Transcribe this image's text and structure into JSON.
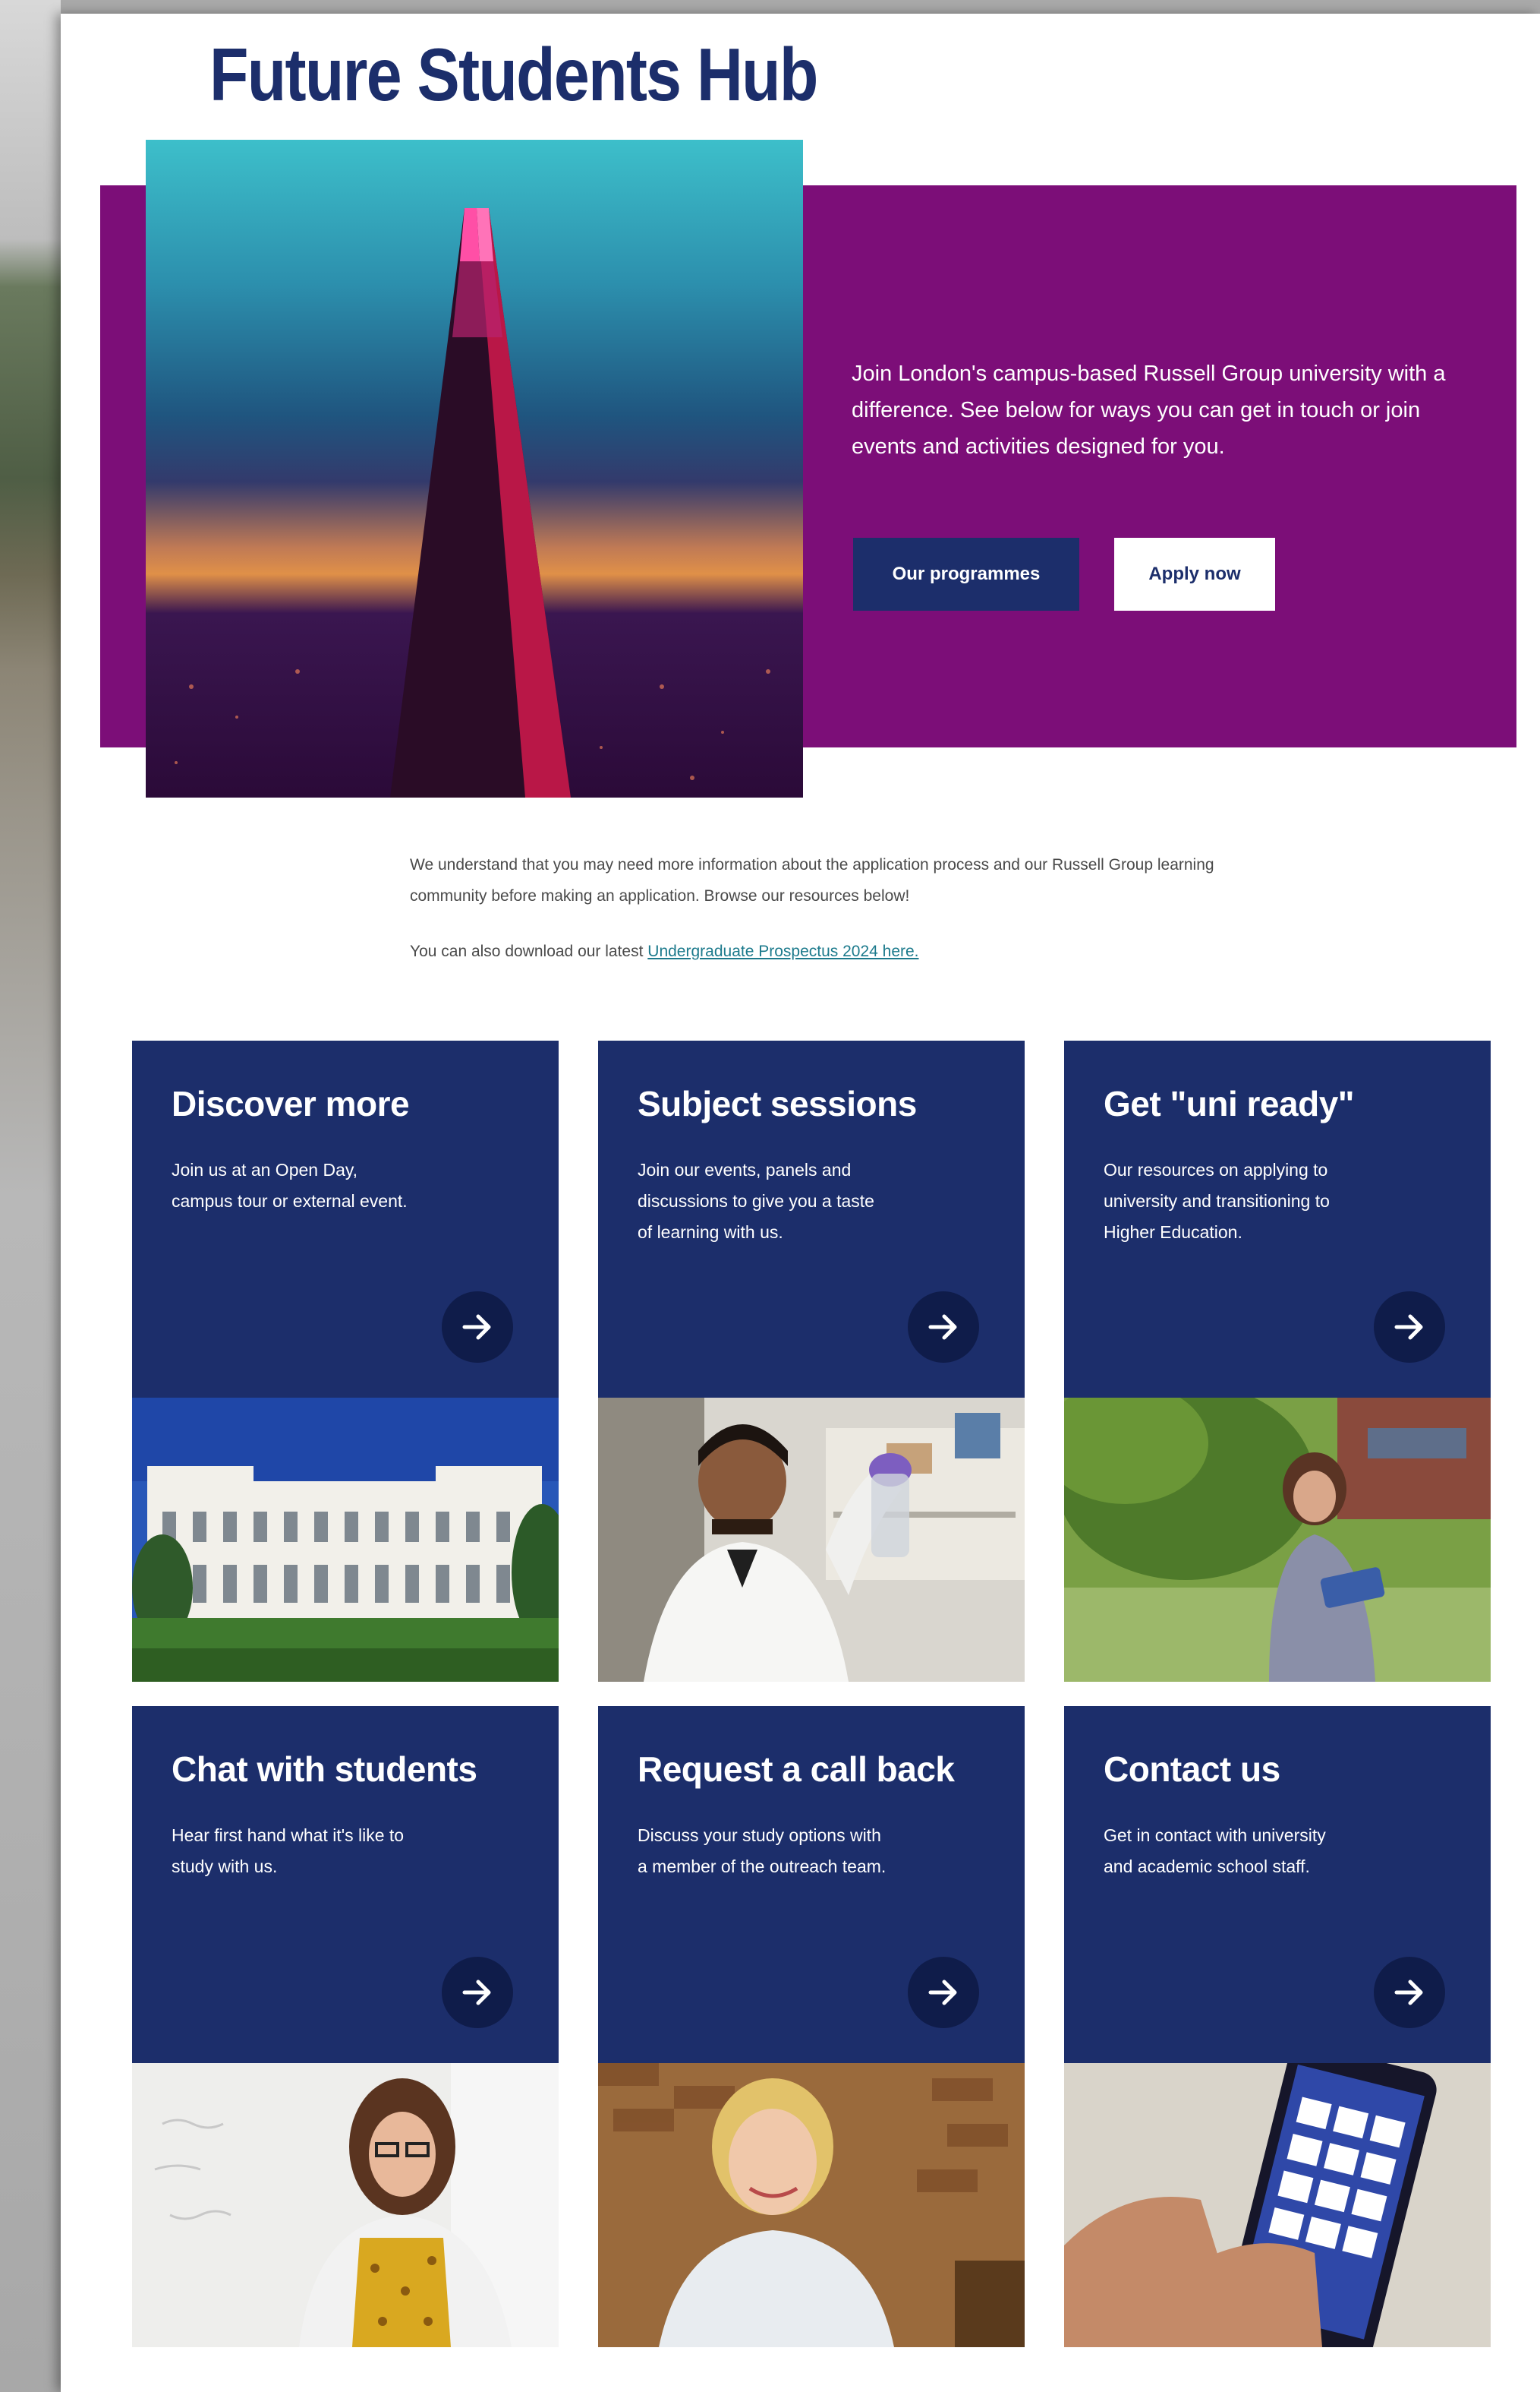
{
  "page": {
    "title": "Future Students Hub"
  },
  "hero": {
    "text": "Join London's campus-based Russell Group university with a difference. See below for ways you can get in touch or join events and activities designed for you.",
    "primary_button": "Our programmes",
    "secondary_button": "Apply now"
  },
  "intro": {
    "paragraph": "We understand that you may need more information about the application process and our Russell Group learning community before making an application. Browse our resources below!",
    "prospectus_prefix": "You can also download our latest ",
    "prospectus_link": "Undergraduate Prospectus 2024 here."
  },
  "cards": [
    {
      "title": "Discover more",
      "description": "Join us at an Open Day, campus tour or external event.",
      "icon": "arrow-right-icon",
      "image": "university-building-photo"
    },
    {
      "title": "Subject sessions",
      "description": "Join our events, panels and discussions to give you a taste of learning with us.",
      "icon": "arrow-right-icon",
      "image": "lab-researcher-photo"
    },
    {
      "title": "Get \"uni ready\"",
      "description": "Our resources on applying to university and transitioning to Higher Education.",
      "icon": "arrow-right-icon",
      "image": "student-reading-outdoors-photo"
    },
    {
      "title": "Chat with students",
      "description": "Hear first hand what it's like to study with us.",
      "icon": "arrow-right-icon",
      "image": "student-whiteboard-photo"
    },
    {
      "title": "Request a call back",
      "description": "Discuss your study options with a member of the outreach team.",
      "icon": "arrow-right-icon",
      "image": "smiling-student-photo"
    },
    {
      "title": "Contact us",
      "description": "Get in contact with university and academic school staff.",
      "icon": "arrow-right-icon",
      "image": "phone-in-hand-photo"
    }
  ],
  "colors": {
    "navy": "#1c2e6b",
    "purple": "#7c0e78",
    "white": "#ffffff"
  }
}
